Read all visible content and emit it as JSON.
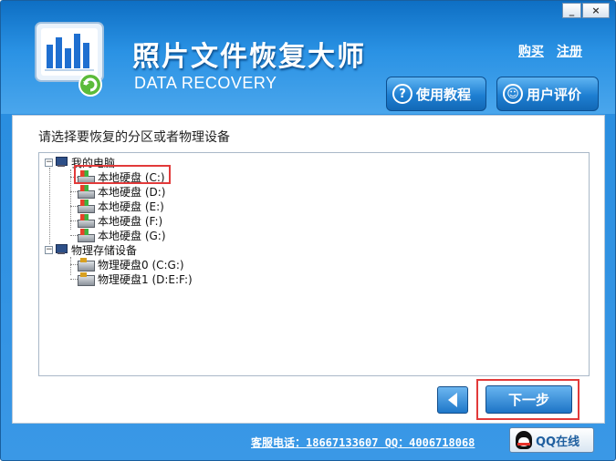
{
  "window": {
    "title": "照片文件恢复大师",
    "subtitle": "DATA RECOVERY",
    "controls": {
      "minimize": "_",
      "close": "×"
    }
  },
  "header": {
    "links": [
      "购买",
      "注册"
    ],
    "buttons": [
      {
        "label": "使用教程",
        "icon": "question-icon"
      },
      {
        "label": "用户评价",
        "icon": "review-icon"
      }
    ]
  },
  "main": {
    "prompt": "请选择要恢复的分区或者物理设备",
    "tree": {
      "groups": [
        {
          "label": "我的电脑",
          "icon": "computer-icon",
          "expander": "−",
          "children": [
            {
              "label": "本地硬盘 (C:)",
              "selected": true
            },
            {
              "label": "本地硬盘 (D:)"
            },
            {
              "label": "本地硬盘 (E:)"
            },
            {
              "label": "本地硬盘 (F:)"
            },
            {
              "label": "本地硬盘 (G:)"
            }
          ]
        },
        {
          "label": "物理存储设备",
          "icon": "computer-icon",
          "expander": "−",
          "children": [
            {
              "label": "物理硬盘0 (C:G:)"
            },
            {
              "label": "物理硬盘1 (D:E:F:)"
            }
          ]
        }
      ]
    },
    "back_label": "",
    "next_label": "下一步"
  },
  "footer": {
    "contact": "客服电话：18667133607 QQ：4006718068",
    "qq_button": "QQ在线"
  },
  "colors": {
    "accent": "#2a8ee0",
    "highlight_border": "#e23a3a"
  }
}
